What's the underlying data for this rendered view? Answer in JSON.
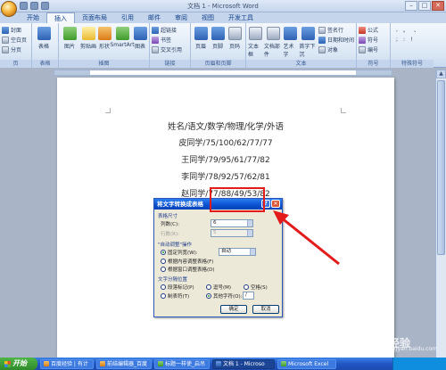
{
  "window": {
    "title": "文档 1 - Microsoft Word",
    "min": "–",
    "max": "□",
    "close": "✕"
  },
  "tabs": [
    "开始",
    "插入",
    "页面布局",
    "引用",
    "邮件",
    "审阅",
    "视图",
    "开发工具"
  ],
  "active_tab": "插入",
  "ribbon": {
    "groups": {
      "pages": {
        "label": "页",
        "items": [
          "封面",
          "空白页",
          "分页"
        ]
      },
      "table": {
        "label": "表格",
        "items": [
          "表格"
        ]
      },
      "illustrations": {
        "label": "插图",
        "items": [
          "图片",
          "剪贴画",
          "形状",
          "SmartArt",
          "图表"
        ]
      },
      "links": {
        "label": "链接",
        "items": [
          "超链接",
          "书签",
          "交叉引用"
        ]
      },
      "header_footer": {
        "label": "页眉和页脚",
        "items": [
          "页眉",
          "页脚",
          "页码"
        ]
      },
      "text": {
        "label": "文本",
        "items": [
          "文本框",
          "文档部件",
          "艺术字",
          "首字下沉",
          "签名行",
          "日期和时间",
          "对象"
        ]
      },
      "symbols": {
        "label": "符号",
        "items": [
          "公式",
          "符号",
          "编号"
        ]
      },
      "special": {
        "label": "特殊符号",
        "items": []
      }
    }
  },
  "document": {
    "lines": [
      "姓名/语文/数学/物理/化学/外语",
      "皮同学/75/100/62/77/77",
      "王同学/79/95/61/77/82",
      "李同学/78/92/57/62/81",
      "赵同学/77/88/49/53/82"
    ]
  },
  "dialog": {
    "title": "将文字转换成表格",
    "help": "?",
    "close": "✕",
    "table_size_label": "表格尺寸",
    "columns_label": "列数(C):",
    "columns_value": "6",
    "rows_label": "行数(R):",
    "rows_value": "5",
    "autofit_label": "\"自动调整\"操作",
    "fixed_width_label": "固定列宽(W):",
    "fixed_width_value": "自动",
    "fit_content_label": "根据内容调整表格(F)",
    "fit_window_label": "根据窗口调整表格(D)",
    "separator_label": "文字分隔位置",
    "paragraph_label": "段落标记(P)",
    "comma_label": "逗号(M)",
    "space_label": "空格(S)",
    "tab_label": "制表符(T)",
    "other_label": "其他字符(O):",
    "other_value": "/",
    "ok_label": "确定",
    "cancel_label": "取消"
  },
  "taskbar": {
    "start": "开始",
    "items": [
      "百度经验 | 有计",
      "前结编辑器_百度",
      "标题一样使_启吊",
      "文档 1 - Microso",
      "Microsoft Excel"
    ],
    "active_index": 3
  },
  "watermark": {
    "site": "jingyan.baidu.com"
  },
  "colors": {
    "annotation": "#e31b1b",
    "taskbar": "#2157c4",
    "dialog_title": "#0a4fcf",
    "ribbon": "#dbe7f5"
  }
}
